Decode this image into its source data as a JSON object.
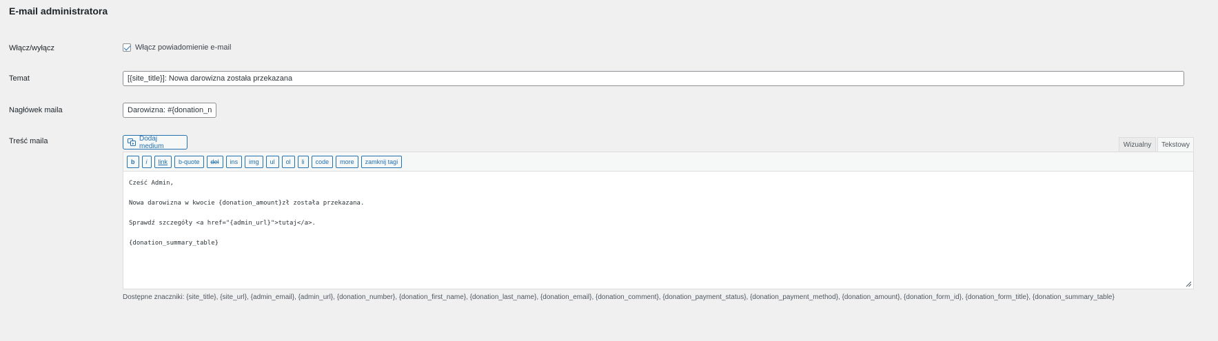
{
  "section": {
    "title": "E-mail administratora"
  },
  "toggle": {
    "label": "Włącz/wyłącz",
    "checkbox_label": "Włącz powiadomienie e-mail",
    "checked": true
  },
  "subject": {
    "label": "Temat",
    "value": "[{site_title}]: Nowa darowizna została przekazana"
  },
  "email_header": {
    "label": "Nagłówek maila",
    "value": "Darowizna: #{donation_nu"
  },
  "body": {
    "label": "Treść maila",
    "add_media_label": "Dodaj medium",
    "tabs": {
      "visual": "Wizualny",
      "text": "Tekstowy"
    },
    "quicktags": [
      "b",
      "i",
      "link",
      "b-quote",
      "del",
      "ins",
      "img",
      "ul",
      "ol",
      "li",
      "code",
      "more",
      "zamknij tagi"
    ],
    "lines": [
      "Cześć Admin,",
      "",
      "Nowa darowizna w kwocie {donation_amount}zł została przekazana.",
      "",
      "Sprawdź szczegóły <a href=\"{admin_url}\">tutaj</a>.",
      "",
      "{donation_summary_table}"
    ]
  },
  "tags_help": "Dostępne znaczniki: {site_title}, {site_url}, {admin_email}, {admin_url}, {donation_number}, {donation_first_name}, {donation_last_name}, {donation_email}, {donation_comment}, {donation_payment_status}, {donation_payment_method}, {donation_amount}, {donation_form_id}, {donation_form_title}, {donation_summary_table}",
  "colors": {
    "accent": "#2271b1",
    "background": "#f0f0f1",
    "border": "#8c8f94"
  }
}
